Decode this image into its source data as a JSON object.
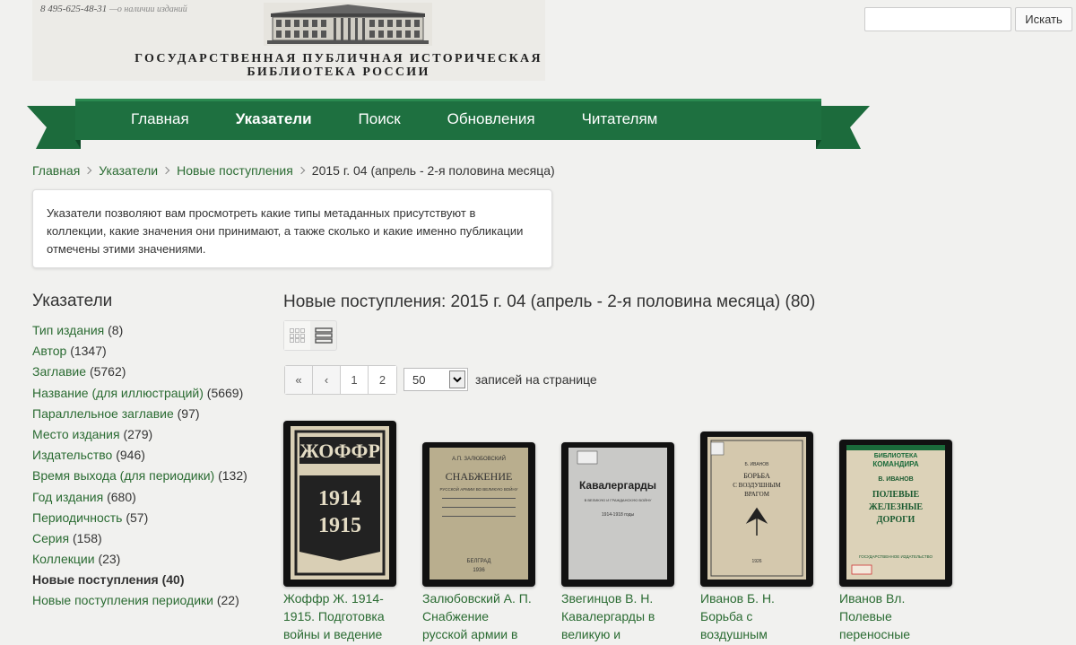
{
  "header": {
    "phone": "8 495-625-48-31",
    "phone_note": "—о наличии изданий",
    "title_line1": "ГОСУДАРСТВЕННАЯ ПУБЛИЧНАЯ ИСТОРИЧЕСКАЯ",
    "title_line2": "БИБЛИОТЕКА РОССИИ",
    "search_placeholder": "",
    "search_button": "Искать"
  },
  "nav": {
    "items": [
      "Главная",
      "Указатели",
      "Поиск",
      "Обновления",
      "Читателям"
    ],
    "active": "Указатели"
  },
  "breadcrumb": [
    "Главная",
    "Указатели",
    "Новые поступления",
    "2015 г. 04 (апрель - 2-я половина месяца)"
  ],
  "info_text": "Указатели позволяют вам просмотреть какие типы метаданных присутствуют в коллекции, какие значения они принимают, а также сколько и какие именно публикации отмечены этими значениями.",
  "sidebar": {
    "title": "Указатели",
    "items": [
      {
        "label": "Тип издания",
        "count": "(8)"
      },
      {
        "label": "Автор",
        "count": "(1347)"
      },
      {
        "label": "Заглавие",
        "count": "(5762)"
      },
      {
        "label": "Название (для иллюстраций)",
        "count": "(5669)"
      },
      {
        "label": "Параллельное заглавие",
        "count": "(97)"
      },
      {
        "label": "Место издания",
        "count": "(279)"
      },
      {
        "label": "Издательство",
        "count": "(946)"
      },
      {
        "label": "Время выхода (для периодики)",
        "count": "(132)"
      },
      {
        "label": "Год издания",
        "count": "(680)"
      },
      {
        "label": "Периодичность",
        "count": "(57)"
      },
      {
        "label": "Серия",
        "count": "(158)"
      },
      {
        "label": "Коллекции",
        "count": "(23)"
      },
      {
        "label": "Новые поступления",
        "count": "(40)"
      },
      {
        "label": "Новые поступления периодики",
        "count": "(22)"
      }
    ],
    "active_index": 12
  },
  "main": {
    "title": "Новые поступления: 2015 г. 04 (апрель - 2-я половина месяца) (80)",
    "pager": [
      "«",
      "‹",
      "1",
      "2"
    ],
    "per_page_value": "50",
    "per_page_label": "записей на странице"
  },
  "books": [
    {
      "caption": "Жоффр Ж. 1914-1915. Подготовка войны и ведение",
      "cover_bg": "#d9cfb5",
      "cover_texts": [
        "ЖОФФР",
        "1914",
        "1915"
      ]
    },
    {
      "caption": "Залюбовский А. П. Снабжение русской армии в великую",
      "cover_bg": "#b9ae8e",
      "cover_texts": [
        "А.П. ЗАЛЮБОВСКИЙ",
        "СНАБЖЕНИЕ",
        "РУССКОЙ АРМИИ ВО ВЕЛИКУЮ ВОЙНУ",
        "БЕЛГРАД",
        "1936"
      ]
    },
    {
      "caption": "Звегинцов В. Н. Кавалергарды в великую и",
      "cover_bg": "#c9c9c7",
      "cover_texts": [
        "Кавалергарды",
        "В ВЕЛИКУЮ И ГРАЖДАНСКУЮ ВОЙНУ",
        "1914-1918 годы"
      ]
    },
    {
      "caption": "Иванов Б. Н. Борьба с воздушным",
      "cover_bg": "#d4c8ad",
      "cover_texts": [
        "Б. ИВАНОВ",
        "БОРЬБА",
        "С ВОЗДУШНЫМ",
        "ВРАГОМ",
        "1926"
      ]
    },
    {
      "caption": "Иванов Вл. Полевые переносные",
      "cover_bg": "#dcd2b8",
      "cover_texts": [
        "БИБЛИОТЕКА",
        "КОМАНДИРА",
        "В. ИВАНОВ",
        "ПОЛЕВЫЕ",
        "ЖЕЛЕЗНЫЕ",
        "ДОРОГИ",
        "ГОСУДАРСТВЕННОЕ ИЗДАТЕЛЬСТВО"
      ]
    }
  ],
  "colors": {
    "ribbon": "#1c6b3c",
    "ribbon_dark": "#0f4a28",
    "link": "#2a6b32"
  }
}
